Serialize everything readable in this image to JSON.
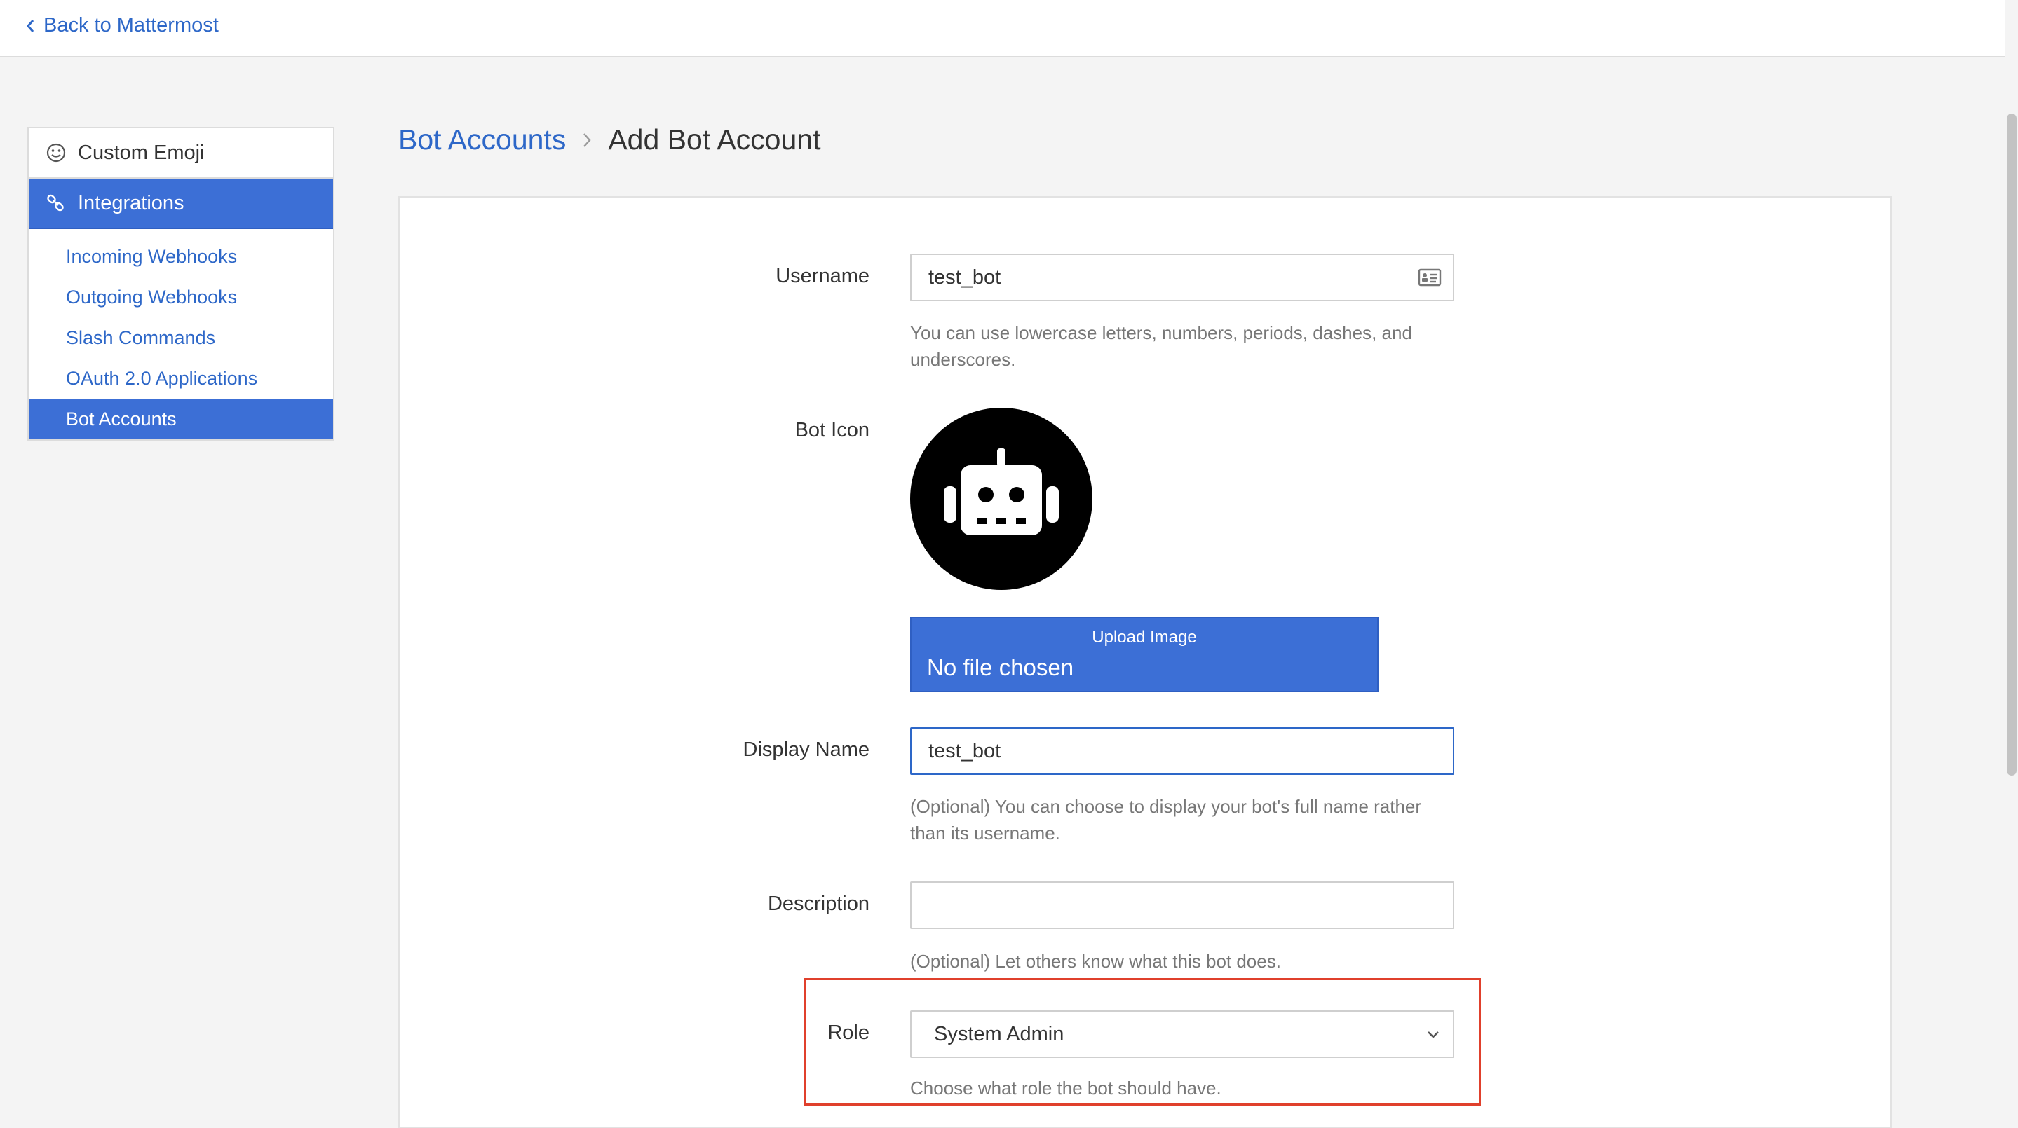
{
  "topbar": {
    "back_label": "Back to Mattermost"
  },
  "sidebar": {
    "sections": [
      {
        "label": "Custom Emoji",
        "icon": "smiley-icon"
      },
      {
        "label": "Integrations",
        "icon": "link-icon"
      }
    ],
    "items": [
      {
        "label": "Incoming Webhooks"
      },
      {
        "label": "Outgoing Webhooks"
      },
      {
        "label": "Slash Commands"
      },
      {
        "label": "OAuth 2.0 Applications"
      },
      {
        "label": "Bot Accounts"
      }
    ]
  },
  "breadcrumb": {
    "parent": "Bot Accounts",
    "current": "Add Bot Account"
  },
  "form": {
    "username": {
      "label": "Username",
      "value": "test_bot",
      "help": "You can use lowercase letters, numbers, periods, dashes, and underscores."
    },
    "bot_icon": {
      "label": "Bot Icon",
      "upload_label": "Upload Image",
      "file_status": "No file chosen"
    },
    "display_name": {
      "label": "Display Name",
      "value": "test_bot",
      "help": "(Optional) You can choose to display your bot's full name rather than its username."
    },
    "description": {
      "label": "Description",
      "value": "",
      "help": "(Optional) Let others know what this bot does."
    },
    "role": {
      "label": "Role",
      "selected": "System Admin",
      "help": "Choose what role the bot should have."
    }
  },
  "colors": {
    "accent": "#3c6fd6",
    "link": "#2d67c8",
    "highlight": "#e0402c"
  }
}
